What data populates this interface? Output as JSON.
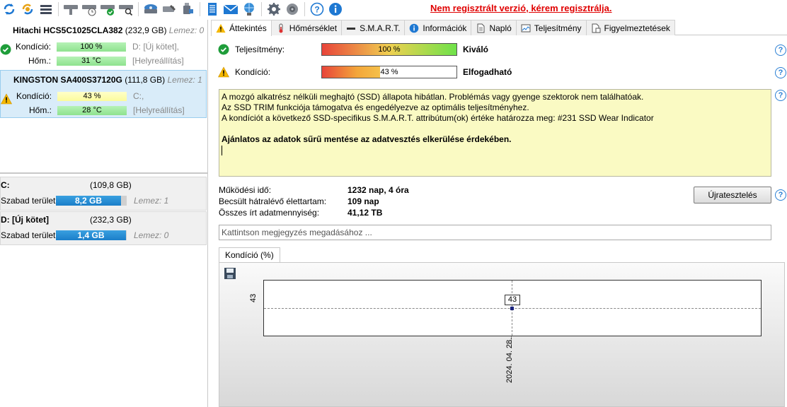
{
  "toolbar": {
    "icons": [
      "refresh-icon",
      "refresh-all-icon",
      "disk-list-icon",
      "hdd-icon",
      "hdd-clock-icon",
      "hdd-check-icon",
      "hdd-search-icon",
      "drive-icon",
      "drive-tools-icon",
      "usb-drive-icon",
      "notes-icon",
      "mail-icon",
      "network-icon",
      "settings-icon",
      "speaker-icon",
      "help-icon",
      "info-icon"
    ],
    "unregistered_text": "Nem regisztrált verzió, kérem regisztrálja."
  },
  "disks": [
    {
      "name": "Hitachi HCS5C1025CLA382",
      "size": "(232,9 GB)",
      "lemez": "Lemez: 0",
      "status": "ok",
      "kondicio_label": "Kondíció:",
      "kondicio_value": "100 %",
      "kondicio_extra": "D: [Új kötet],",
      "hom_label": "Hőm.:",
      "hom_value": "31 °C",
      "hom_extra": "[Helyreállítás]"
    },
    {
      "name": "KINGSTON SA400S37120G",
      "size": "(111,8 GB)",
      "lemez": "Lemez: 1",
      "status": "warning",
      "kondicio_label": "Kondíció:",
      "kondicio_value": "43 %",
      "kondicio_extra": "C:,",
      "hom_label": "Hőm.:",
      "hom_value": "28 °C",
      "hom_extra": "[Helyreállítás]"
    }
  ],
  "volumes": [
    {
      "name": "C:",
      "size": "(109,8 GB)",
      "free_label": "Szabad terület",
      "free_value": "8,2 GB",
      "free_fraction": 0.075,
      "lemez": "Lemez: 1"
    },
    {
      "name": "D: [Új kötet]",
      "size": "(232,3 GB)",
      "free_label": "Szabad terület",
      "free_value": "1,4 GB",
      "free_fraction": 0.006,
      "lemez": "Lemez: 0"
    }
  ],
  "tabs": [
    "Áttekintés",
    "Hőmérséklet",
    "S.M.A.R.T.",
    "Információk",
    "Napló",
    "Teljesítmény",
    "Figyelmeztetések"
  ],
  "overview": {
    "performance_label": "Teljesítmény:",
    "performance_value": "100 %",
    "performance_fraction": 1.0,
    "performance_result": "Kiváló",
    "condition_label": "Kondíció:",
    "condition_value": "43 %",
    "condition_fraction": 0.43,
    "condition_result": "Elfogadható",
    "note_lines": [
      "A mozgó alkatrész nélküli meghajtó (SSD) állapota hibátlan. Problémás vagy gyenge szektorok nem találhatóak.",
      "Az SSD TRIM funkciója támogatva és engedélyezve az optimális teljesítményhez.",
      "A kondíciót a következő SSD-specifikus S.M.A.R.T. attribútum(ok) értéke határozza meg:  #231 SSD Wear Indicator"
    ],
    "note_bold": "Ajánlatos az adatok sűrű mentése az adatvesztés elkerülése érdekében.",
    "info": [
      {
        "key": "Működési idő:",
        "value": "1232 nap, 4 óra"
      },
      {
        "key": "Becsült hátralévő élettartam:",
        "value": "109 nap"
      },
      {
        "key": "Összes írt adatmennyiség:",
        "value": "41,12 TB"
      }
    ],
    "retest_label": "Újratesztelés",
    "comment_placeholder": "Kattintson megjegyzés megadásához ..."
  },
  "graph_tab": "Kondíció  (%)",
  "chart_data": {
    "type": "line",
    "x": [
      "2024. 04. 28."
    ],
    "series": [
      {
        "values": [
          43
        ]
      }
    ],
    "data_labels": [
      "43"
    ],
    "y_tick_labels": [
      "43"
    ],
    "x_tick_labels": [
      "2024. 04. 28."
    ],
    "grid": true
  }
}
